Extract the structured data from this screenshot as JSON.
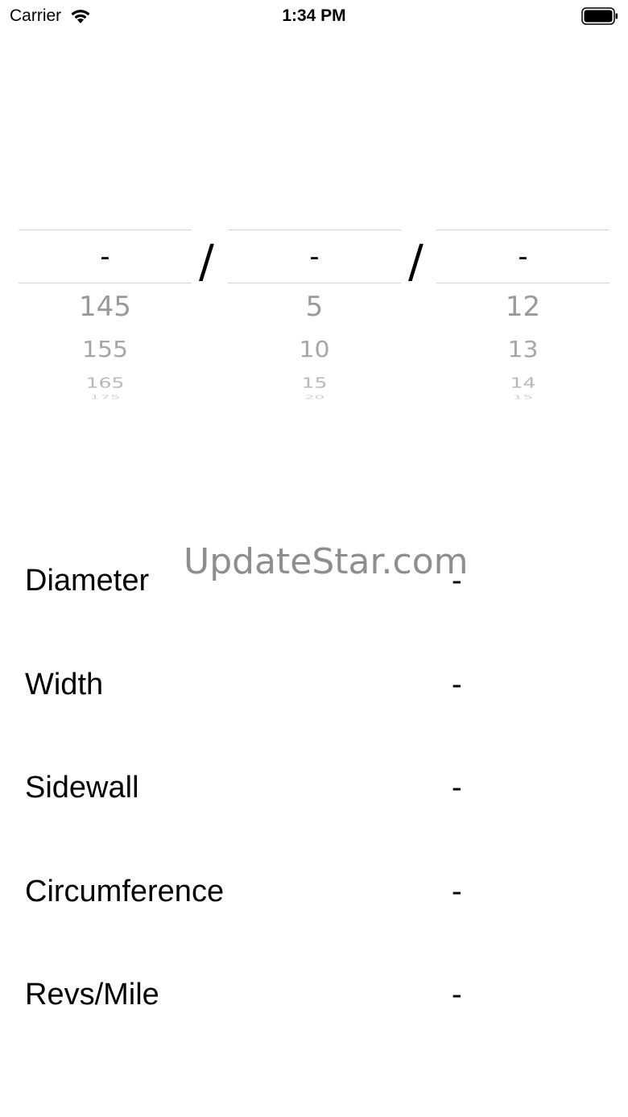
{
  "status_bar": {
    "carrier": "Carrier",
    "time": "1:34 PM"
  },
  "picker": {
    "columns": [
      {
        "selected": "-",
        "options": [
          "145",
          "155",
          "165",
          "175"
        ]
      },
      {
        "selected": "-",
        "options": [
          "5",
          "10",
          "15",
          "20"
        ]
      },
      {
        "selected": "-",
        "options": [
          "12",
          "13",
          "14",
          "15"
        ]
      }
    ],
    "separator": "/"
  },
  "watermark": "UpdateStar.com",
  "results": [
    {
      "label": "Diameter",
      "value": "-"
    },
    {
      "label": "Width",
      "value": "-"
    },
    {
      "label": "Sidewall",
      "value": "-"
    },
    {
      "label": "Circumference",
      "value": "-"
    },
    {
      "label": "Revs/Mile",
      "value": "-"
    }
  ],
  "icons": {
    "wifi": "wifi-icon",
    "battery": "battery-icon"
  }
}
